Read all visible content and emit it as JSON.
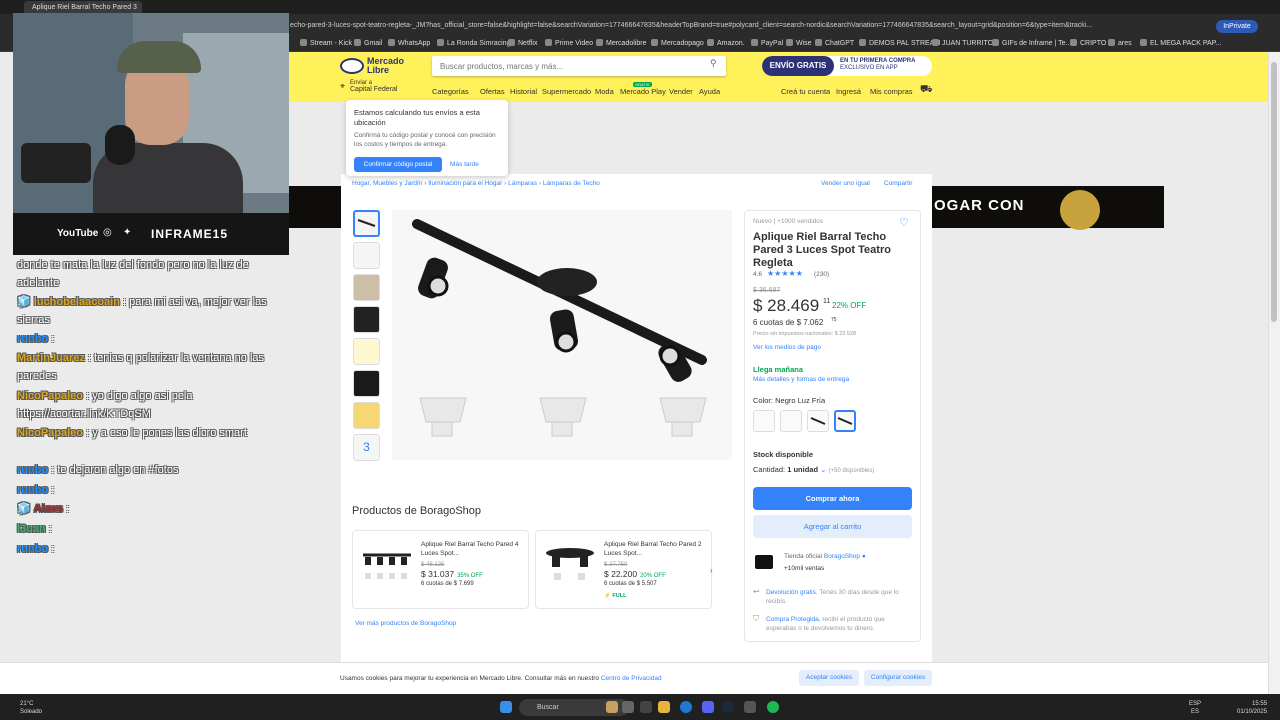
{
  "browser": {
    "tab_title": "Aplique Riel Barral Techo Pared 3",
    "url": "echo-pared-3-luces-spot-teatro-regleta-_JM?has_official_store=false&highlight=false&searchVariation=177466647835&headerTopBrand=true#polycard_client=search-nordic&searchVariation=177466647835&search_layout=grid&position=6&type=item&tracki...",
    "inprivate": "InPrivate",
    "bookmarks": [
      "Stream - Kick",
      "Gmail",
      "WhatsApp",
      "La Ronda Simracing",
      "Netflix",
      "Prime Video",
      "Mercadolibre",
      "Mercadopago",
      "Amazon.",
      "PayPal",
      "Wise",
      "ChatGPT",
      "DEMOS PAL STREAM",
      "JUAN TURRITO",
      "GIFs de Inframe | Te...",
      "CRIPTO",
      "ares",
      "EL MEGA PACK PAP..."
    ]
  },
  "header": {
    "logo_line1": "Mercado",
    "logo_line2": "Libre",
    "search_placeholder": "Buscar productos, marcas y más...",
    "promo_a": "ENVÍO GRATIS",
    "promo_b1": "EN TU PRIMERA COMPRA",
    "promo_b2": "EXCLUSIVO EN APP",
    "loc_small": "Enviar a",
    "loc_city": "Capital Federal",
    "nav": [
      "Categorías",
      "Ofertas",
      "Historial",
      "Supermercado",
      "Moda",
      "Mercado Play",
      "Vender",
      "Ayuda"
    ],
    "nav_badge": "GRATIS",
    "account": [
      "Creá tu cuenta",
      "Ingresá",
      "Mis compras"
    ]
  },
  "tooltip": {
    "title": "Estamos calculando tus envíos a esta ubicación",
    "body": "Confirmá tu código postal y conocé con precisión los costos y tiempos de entrega.",
    "confirm": "Confirmar código postal",
    "later": "Más tarde"
  },
  "banner_text": "OGAR CON",
  "breadcrumb": [
    "Hogar, Muebles y Jardín",
    "Iluminación para el Hogar",
    "Lámparas",
    "Lámparas de Techo"
  ],
  "crumb_sep": "›",
  "crumb_actions": [
    "Vender uno igual",
    "Compartir"
  ],
  "thumb_more": "3",
  "product": {
    "condition": "Nuevo  |  +1000 vendidos",
    "title": "Aplique Riel Barral Techo Pared 3 Luces Spot Teatro Regleta",
    "rating": "4.6",
    "stars": "★★★★★",
    "reviews": "(230)",
    "old_price": "$ 36.687",
    "price": "$ 28.469",
    "price_cents": "11",
    "discount": "22% OFF",
    "installments": "6 cuotas de $ 7.062",
    "installments_cents": "75",
    "taxes": "Precio sin impuestos nacionales: $ 23.528",
    "payments_link": "Ver los medios de pago",
    "delivery": "Llega mañana",
    "delivery_link": "Más detalles y formas de entrega",
    "color_label": "Color:",
    "color_value": "Negro Luz Fría",
    "stock": "Stock disponible",
    "qty_label": "Cantidad:",
    "qty_value": "1 unidad",
    "qty_avail": "(+50 disponibles)",
    "buy": "Comprar ahora",
    "cart": "Agregar al carrito",
    "store_prefix": "Tienda oficial",
    "store_name": "BoragoShop",
    "store_sales": "+10mil ventas",
    "return_link": "Devolución gratis.",
    "return_text": "Tenés 30 días desde que lo recibís.",
    "protect_link": "Compra Protegida,",
    "protect_text": "recibí el producto que esperabas o te devolvemos tu dinero."
  },
  "shop": {
    "title": "Productos de BoragoShop",
    "items": [
      {
        "title": "Aplique Riel Barral Techo Pared 4 Luces Spot...",
        "old": "$ 48.125",
        "price": "$ 31.037",
        "off": "35% OFF",
        "cuotas": "6 cuotas de $ 7.699",
        "full": ""
      },
      {
        "title": "Aplique Riel Barral Techo Pared 2 Luces Spot...",
        "old": "$ 27.750",
        "price": "$ 22.200",
        "off": "20% OFF",
        "cuotas": "6 cuotas de $ 5.507",
        "full": "⚡ FULL"
      }
    ],
    "chevron": "›",
    "more": "Ver más productos de BoragoShop"
  },
  "cookie": {
    "msg": "Usamos cookies para mejorar tu experiencia en Mercado Libre. Consultar más en nuestro",
    "link": "Centro de Privacidad",
    "accept": "Aceptar cookies",
    "config": "Configurar cookies"
  },
  "stream": {
    "youtube": "YouTube",
    "instagram_glyph": "◎",
    "twitter_glyph": "✦",
    "name": "INFRAME15"
  },
  "chat": [
    {
      "user": "",
      "text": "donde te mata la luz del fondo pero no la luz de adelante",
      "color": "#ffffff"
    },
    {
      "user": "luchobelaacoain",
      "text": " : para mi asi va, mejor ver las sierras",
      "color": "#daa520"
    },
    {
      "user": "runbo",
      "text": " :",
      "color": "#1e90ff"
    },
    {
      "user": "MartinJuarez",
      "text": " : tenias q polarizar la ventana no las paredes",
      "color": "#daa520"
    },
    {
      "user": "NicoPapaleo",
      "text": " : yo digo algo asi pela https://acortar.link/KTDqSM",
      "color": "#daa520"
    },
    {
      "user": "NicoPapaleo",
      "text": " : y a eso le pones las dicro smart",
      "color": "#daa520"
    },
    {
      "user": "runbo",
      "text": " : te dejaron algo en #fotos",
      "color": "#1e90ff"
    },
    {
      "user": "runbo",
      "text": " :",
      "color": "#1e90ff"
    },
    {
      "user": "Alaxs",
      "text": " :",
      "color": "#b22222"
    },
    {
      "user": "l3uan",
      "text": " :",
      "color": "#3cb371"
    },
    {
      "user": "runbo",
      "text": " :",
      "color": "#1e90ff"
    }
  ],
  "taskbar": {
    "temp": "21°C",
    "weather": "Soleado",
    "search": "Buscar",
    "lang1": "ESP",
    "lang2": "ES",
    "time": "15:55",
    "date": "01/10/2025"
  },
  "colors": {
    "ml_yellow": "#fff159",
    "ml_blue": "#3483fa",
    "ml_navy": "#2d3277",
    "discount_green": "#00a650"
  }
}
